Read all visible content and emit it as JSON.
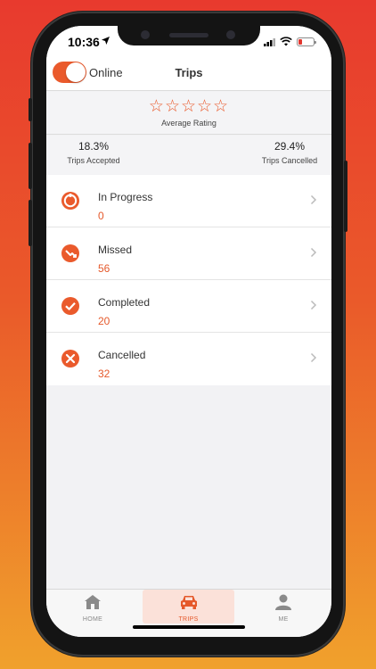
{
  "status_bar": {
    "time": "10:36"
  },
  "header": {
    "online_label": "Online",
    "online_toggle": true,
    "title": "Trips"
  },
  "rating": {
    "stars": "☆☆☆☆☆",
    "value": 0,
    "max": 5,
    "label": "Average Rating"
  },
  "stats": {
    "accepted": {
      "value": "18.3%",
      "label": "Trips Accepted"
    },
    "cancelled": {
      "value": "29.4%",
      "label": "Trips Cancelled"
    }
  },
  "trips": [
    {
      "label": "In Progress",
      "count": "0",
      "icon": "in-progress-icon"
    },
    {
      "label": "Missed",
      "count": "56",
      "icon": "missed-icon"
    },
    {
      "label": "Completed",
      "count": "20",
      "icon": "completed-icon"
    },
    {
      "label": "Cancelled",
      "count": "32",
      "icon": "cancelled-icon"
    }
  ],
  "tabs": [
    {
      "label": "HOME",
      "icon": "home-icon",
      "active": false
    },
    {
      "label": "TRIPS",
      "icon": "car-icon",
      "active": true
    },
    {
      "label": "ME",
      "icon": "user-icon",
      "active": false
    }
  ],
  "colors": {
    "accent": "#ea5a2c",
    "count_text": "#e5592b",
    "active_tab_bg": "#fbe1d9",
    "background_top": "#e83a2e",
    "background_bottom": "#f0a12c"
  }
}
